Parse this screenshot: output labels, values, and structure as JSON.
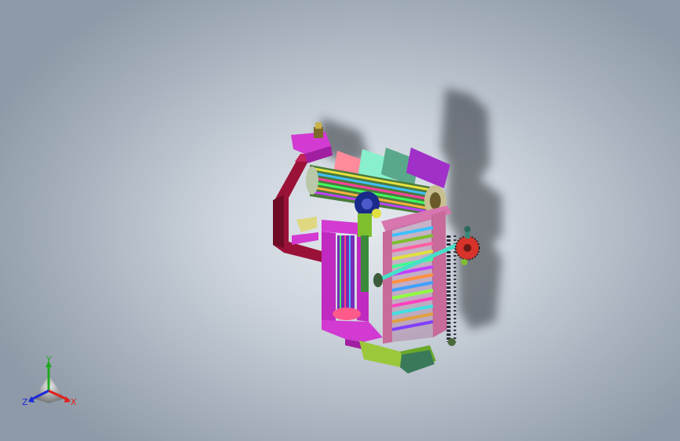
{
  "viewport": {
    "background_top": "#e4e9ee",
    "background_edge": "#8f9aa8"
  },
  "triad": {
    "x_label": "X",
    "y_label": "Y",
    "z_label": "Z",
    "x_color": "#e0201a",
    "y_color": "#1fa81f",
    "z_color": "#1a28d8"
  },
  "model": {
    "icon": "3d-assembly-model",
    "colors": {
      "frame_magenta": "#d23ad2",
      "frame_maroon": "#9a1238",
      "frame_pink": "#c86a9a",
      "panel_green": "#7fbf2e",
      "panel_teal": "#3a8a6a",
      "shaft_cyan": "#46e0c8",
      "sprocket_red": "#d8332a"
    }
  }
}
